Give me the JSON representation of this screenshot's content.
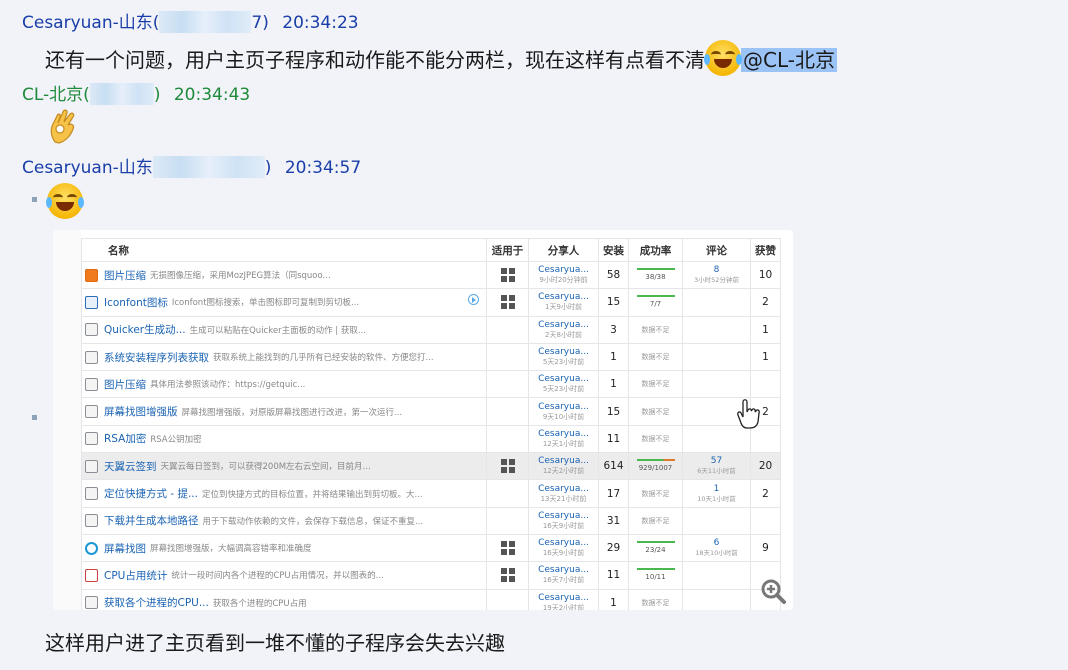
{
  "messages": [
    {
      "sender": "Cesaryuan-山东(",
      "id_tail": "7)",
      "time": "20:34:23"
    },
    {
      "sender": "CL-北京(",
      "id_tail": ")",
      "time": "20:34:43"
    },
    {
      "sender": "Cesaryuan-山东",
      "id_tail": ")",
      "time": "20:34:57"
    }
  ],
  "msg1_text": "还有一个问题，用户主页子程序和动作能不能分两栏，现在这样有点看不清",
  "msg1_mention": "@CL-北京",
  "msg4_text": "这样用户进了主页看到一堆不懂的子程序会失去兴趣",
  "colors": {
    "sender_blue": "#1a3ea8",
    "sender_green": "#1f8a3a",
    "mention_bg": "#9cc3f5",
    "link": "#1a63b3"
  },
  "table": {
    "headers": {
      "name": "名称",
      "for": "适用于",
      "sharer": "分享人",
      "install": "安装",
      "rate": "成功率",
      "comment": "评论",
      "likes": "获赞"
    },
    "rows": [
      {
        "icon": "image-compress-icon",
        "title": "图片压缩",
        "desc": "无损图像压缩，采用MozJPEG算法（同squoo...",
        "win": true,
        "user": "Cesaryua...",
        "ut": "9小时20分钟前",
        "install": "58",
        "rate": "38/38",
        "comment": "8",
        "ct": "3小时52分钟前",
        "likes": "10"
      },
      {
        "icon": "iconfont-icon",
        "title": "Iconfont图标",
        "desc": "Iconfont图标搜索，单击图标即可复制到剪切板...",
        "win": true,
        "user": "Cesaryua...",
        "ut": "1天9小时前",
        "install": "15",
        "rate": "7/7",
        "comment": "",
        "ct": "",
        "likes": "2"
      },
      {
        "icon": "cube-icon",
        "title": "Quicker生成动...",
        "desc": "生成可以粘贴在Quicker主面板的动作 | 获取...",
        "win": false,
        "user": "Cesaryua...",
        "ut": "2天8小时前",
        "install": "3",
        "rate": "数据不足",
        "comment": "",
        "ct": "",
        "likes": "1"
      },
      {
        "icon": "cube-icon",
        "title": "系统安装程序列表获取",
        "desc": "获取系统上能找到的几乎所有已经安装的软件、方便您打...",
        "win": false,
        "user": "Cesaryua...",
        "ut": "5天23小时前",
        "install": "1",
        "rate": "数据不足",
        "comment": "",
        "ct": "",
        "likes": "1"
      },
      {
        "icon": "cube-icon",
        "title": "图片压缩",
        "desc": "具体用法参照该动作：https://getquic...",
        "win": false,
        "user": "Cesaryua...",
        "ut": "5天23小时前",
        "install": "1",
        "rate": "数据不足",
        "comment": "",
        "ct": "",
        "likes": ""
      },
      {
        "icon": "cube-icon",
        "title": "屏幕找图增强版",
        "desc": "屏幕找图增强版，对原版屏幕找图进行改进，第一次运行...",
        "win": false,
        "user": "Cesaryua...",
        "ut": "9天10小时前",
        "install": "15",
        "rate": "数据不足",
        "comment": "",
        "ct": "",
        "likes": "2"
      },
      {
        "icon": "cube-icon",
        "title": "RSA加密",
        "desc": "RSA公钥加密",
        "win": false,
        "user": "Cesaryua...",
        "ut": "12天1小时前",
        "install": "11",
        "rate": "数据不足",
        "comment": "",
        "ct": "",
        "likes": ""
      },
      {
        "icon": "checkin-icon",
        "title": "天翼云签到",
        "desc": "天翼云每日签到，可以获得200M左右云空间，目前月...",
        "win": true,
        "user": "Cesaryua...",
        "ut": "12天2小时前",
        "install": "614",
        "rate": "929/1007",
        "comment": "57",
        "ct": "6天11小时前",
        "likes": "20",
        "hl": true
      },
      {
        "icon": "cube-icon",
        "title": "定位快捷方式 - 提...",
        "desc": "定位到快捷方式的目标位置，并将结果输出到剪切板。大...",
        "win": false,
        "user": "Cesaryua...",
        "ut": "13天21小时前",
        "install": "17",
        "rate": "数据不足",
        "comment": "1",
        "ct": "10天1小时前",
        "likes": "2"
      },
      {
        "icon": "cube-icon",
        "title": "下载并生成本地路径",
        "desc": "用于下载动作依赖的文件，会保存下载信息，保证不重复...",
        "win": false,
        "user": "Cesaryua...",
        "ut": "16天9小时前",
        "install": "31",
        "rate": "数据不足",
        "comment": "",
        "ct": "",
        "likes": ""
      },
      {
        "icon": "screen-search-icon",
        "title": "屏幕找图",
        "desc": "屏幕找图增强版，大幅调高容错率和准确度",
        "win": true,
        "user": "Cesaryua...",
        "ut": "16天9小时前",
        "install": "29",
        "rate": "23/24",
        "comment": "6",
        "ct": "18天10小时前",
        "likes": "9"
      },
      {
        "icon": "cpu-chart-icon",
        "title": "CPU占用统计",
        "desc": "统计一段时间内各个进程的CPU占用情况，并以图表的...",
        "win": true,
        "user": "Cesaryua...",
        "ut": "16天7小时前",
        "install": "11",
        "rate": "10/11",
        "comment": "",
        "ct": "",
        "likes": ""
      },
      {
        "icon": "cube-icon",
        "title": "获取各个进程的CPU...",
        "desc": "获取各个进程的CPU占用",
        "win": false,
        "user": "Cesaryua...",
        "ut": "19天2小时前",
        "install": "1",
        "rate": "数据不足",
        "comment": "",
        "ct": "",
        "likes": ""
      }
    ]
  }
}
